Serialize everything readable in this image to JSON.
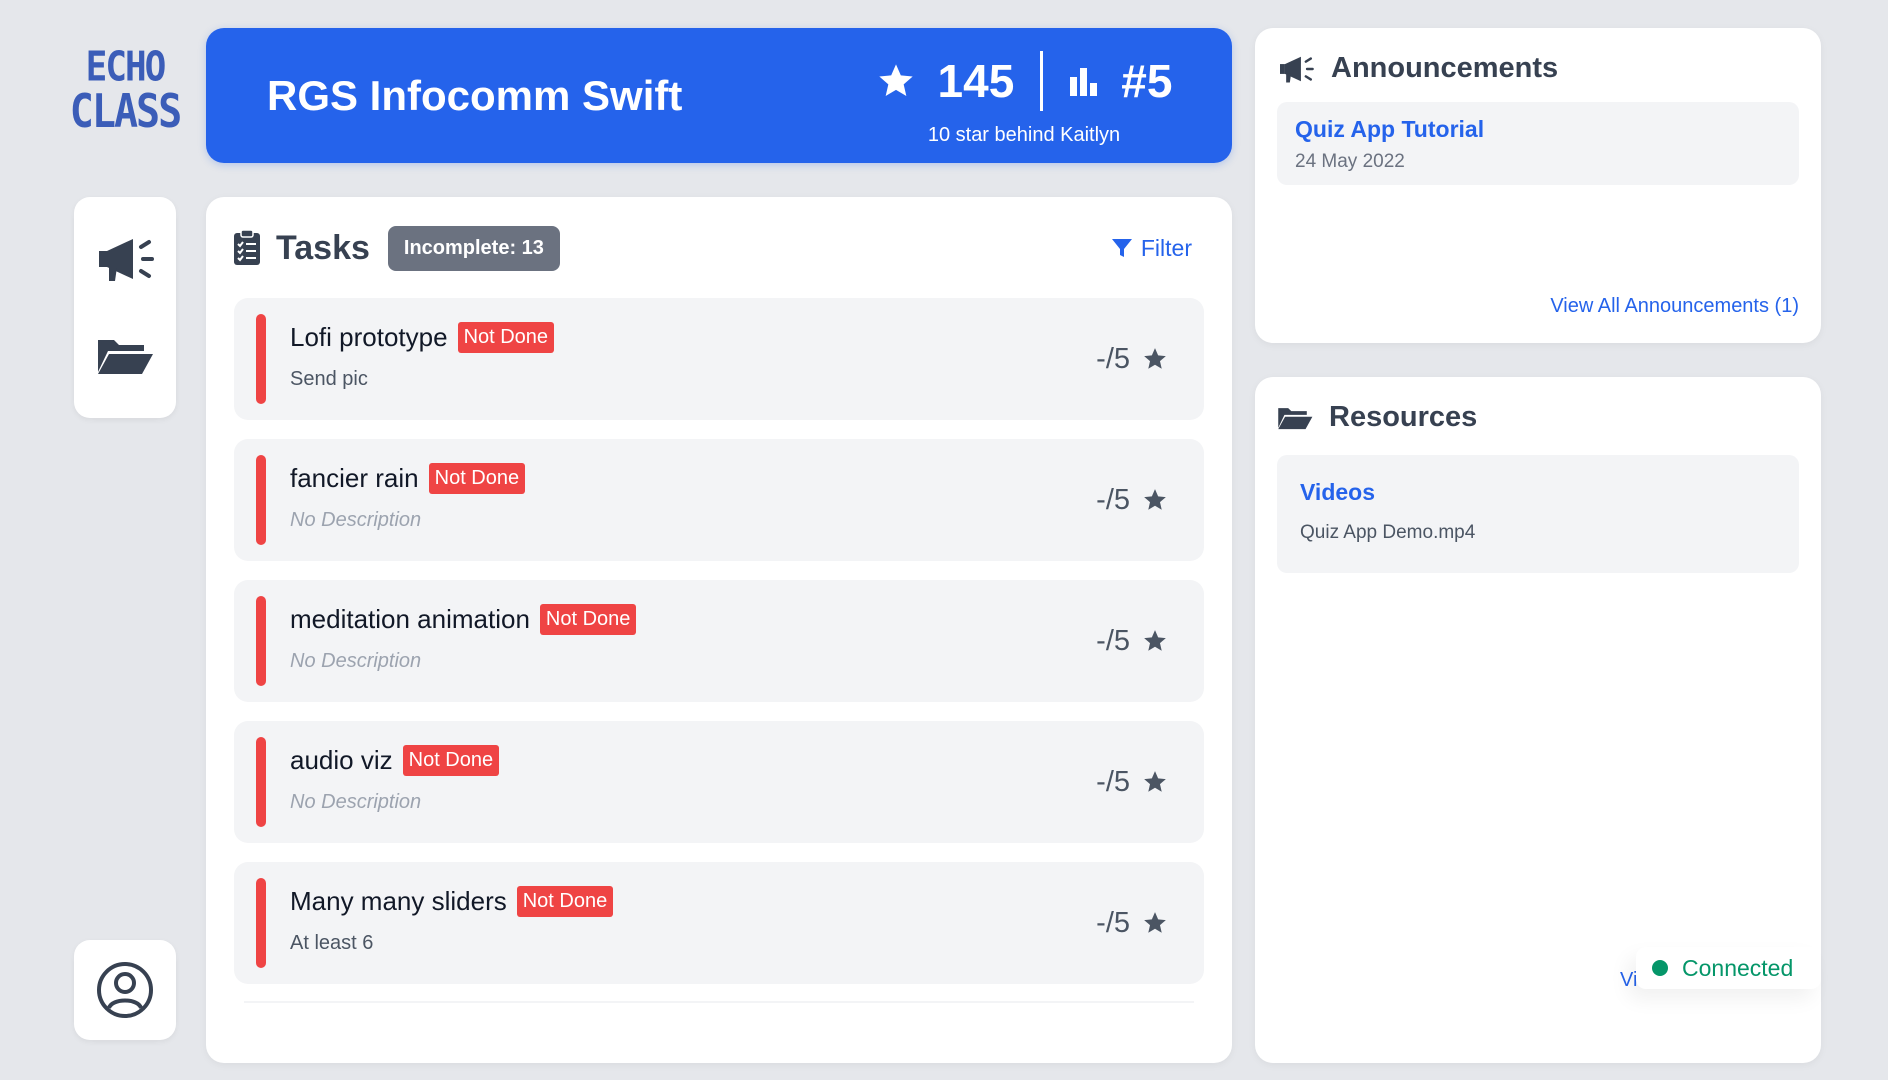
{
  "brand": {
    "line1": "ECHO",
    "line2": "CLASS"
  },
  "nav": {
    "icons": [
      "megaphone-icon",
      "folder-open-icon",
      "user-circle-icon"
    ]
  },
  "header": {
    "class_name": "RGS Infocomm Swift",
    "stars": "145",
    "rank": "#5",
    "rank_note": "10 star behind Kaitlyn"
  },
  "tasks": {
    "title": "Tasks",
    "incomplete_label": "Incomplete: 13",
    "filter_label": "Filter",
    "items": [
      {
        "name": "Lofi prototype",
        "status": "Not Done",
        "description": "Send pic",
        "score": "-/5"
      },
      {
        "name": "fancier rain",
        "status": "Not Done",
        "description": "No Description",
        "score": "-/5"
      },
      {
        "name": "meditation animation",
        "status": "Not Done",
        "description": "No Description",
        "score": "-/5"
      },
      {
        "name": "audio viz",
        "status": "Not Done",
        "description": "No Description",
        "score": "-/5"
      },
      {
        "name": "Many many sliders",
        "status": "Not Done",
        "description": "At least 6",
        "score": "-/5"
      }
    ]
  },
  "announcements": {
    "title": "Announcements",
    "items": [
      {
        "title": "Quiz App Tutorial",
        "date": "24 May 2022"
      }
    ],
    "view_all": "View All Announcements (1)"
  },
  "resources": {
    "title": "Resources",
    "items": [
      {
        "title": "Videos",
        "file": "Quiz App Demo.mp4"
      }
    ],
    "partial_link": "Vi"
  },
  "connection": {
    "label": "Connected"
  },
  "colors": {
    "accent": "#2563eb",
    "danger": "#ef4444",
    "success": "#059669",
    "background": "#e5e7eb"
  }
}
